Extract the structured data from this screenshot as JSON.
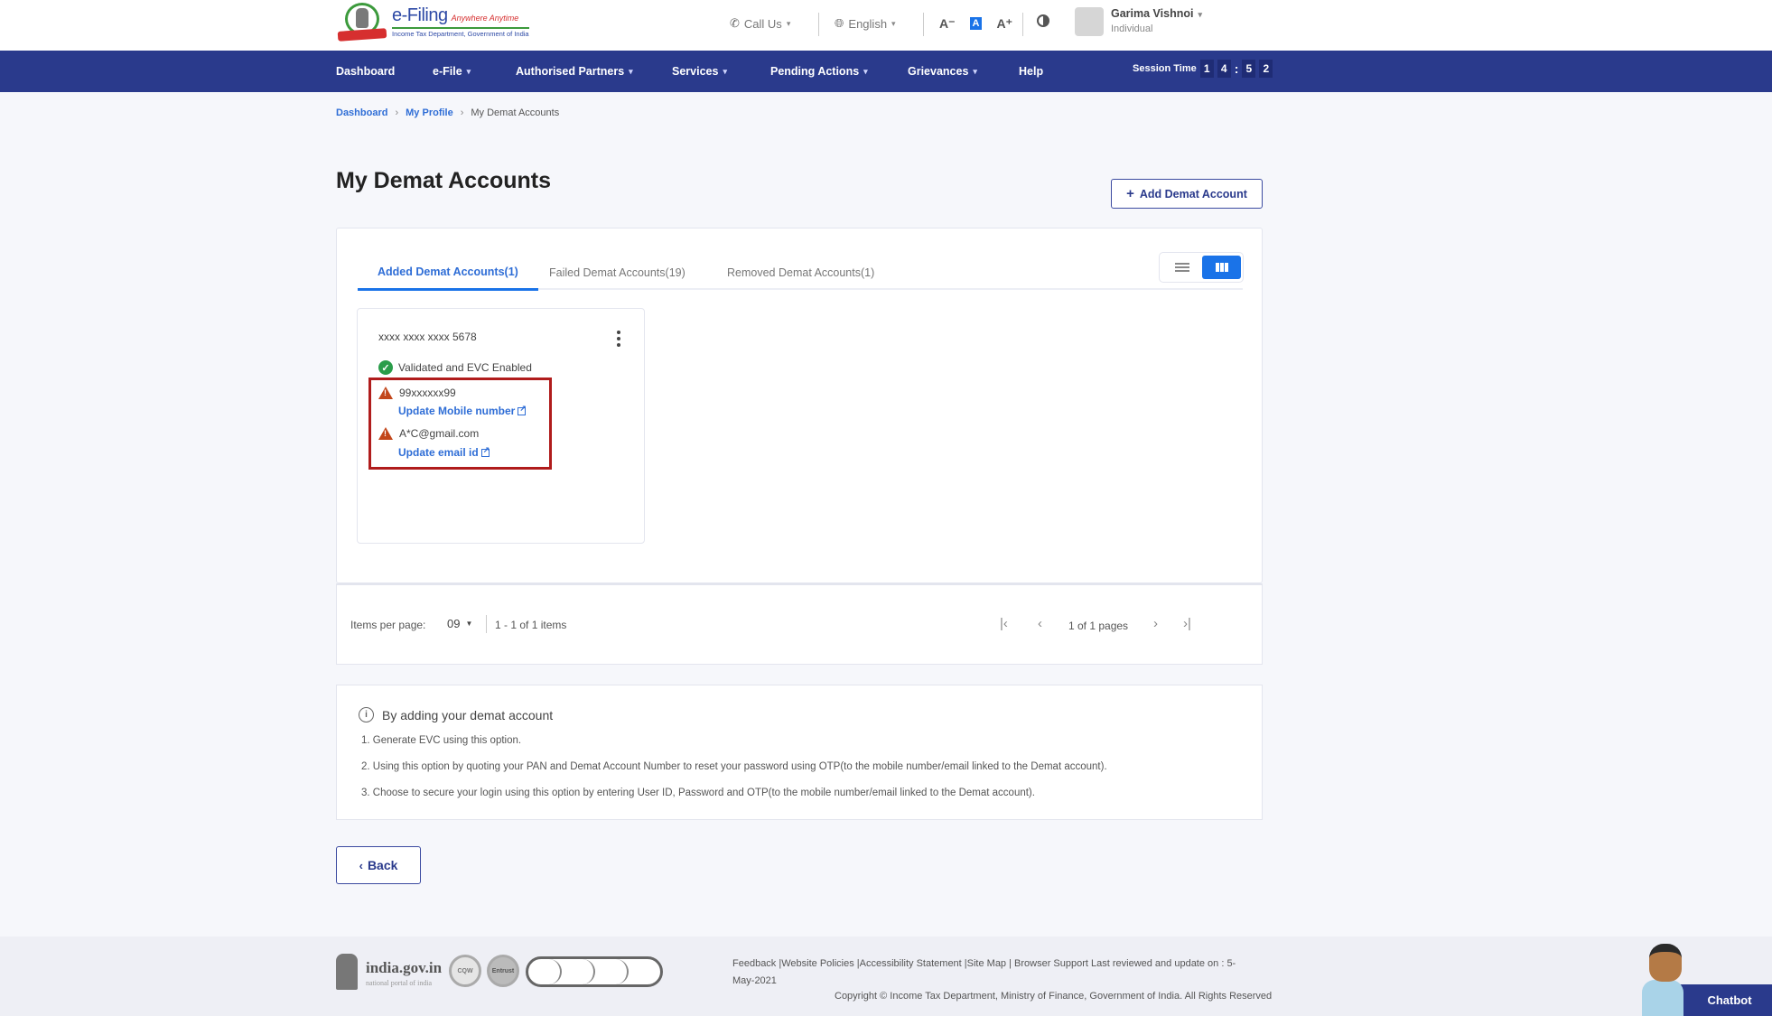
{
  "header": {
    "logo": {
      "title": "e-Filing",
      "tagline": "Anywhere Anytime",
      "subtitle": "Income Tax Department, Government of India"
    },
    "call_us": "Call Us",
    "language": "English",
    "font_decrease": "A⁻",
    "font_default": "A",
    "font_increase": "A⁺",
    "user": {
      "name": "Garima Vishnoi",
      "role": "Individual"
    }
  },
  "nav": {
    "items": [
      {
        "label": "Dashboard",
        "dropdown": false
      },
      {
        "label": "e-File",
        "dropdown": true
      },
      {
        "label": "Authorised Partners",
        "dropdown": true
      },
      {
        "label": "Services",
        "dropdown": true
      },
      {
        "label": "Pending Actions",
        "dropdown": true
      },
      {
        "label": "Grievances",
        "dropdown": true
      },
      {
        "label": "Help",
        "dropdown": false
      }
    ],
    "session_label": "Session Time",
    "session_digits": [
      "1",
      "4",
      "5",
      "2"
    ]
  },
  "breadcrumb": {
    "items": [
      "Dashboard",
      "My Profile"
    ],
    "current": "My Demat Accounts"
  },
  "page": {
    "title": "My Demat Accounts",
    "add_button": "Add Demat Account",
    "back_button": "Back"
  },
  "tabs": [
    {
      "label": "Added Demat Accounts(1)",
      "active": true
    },
    {
      "label": "Failed Demat Accounts(19)",
      "active": false
    },
    {
      "label": "Removed Demat Accounts(1)",
      "active": false
    }
  ],
  "view_mode": "grid",
  "card": {
    "account_number": "xxxx xxxx xxxx 5678",
    "status": "Validated and EVC Enabled",
    "mobile": "99xxxxxx99",
    "update_mobile": "Update Mobile number",
    "email": "A*C@gmail.com",
    "update_email": "Update email id"
  },
  "pagination": {
    "items_per_page_label": "Items per page:",
    "items_per_page": "09",
    "range": "1 - 1 of 1 items",
    "pages": "1 of 1 pages"
  },
  "info": {
    "heading": "By adding your demat account",
    "items": [
      "1. Generate EVC using this option.",
      "2. Using this option by quoting your PAN and Demat Account Number to reset your password using OTP(to the mobile number/email linked to the Demat account).",
      "3. Choose to secure your login using this option by entering User ID, Password and OTP(to the mobile number/email linked to the Demat account)."
    ]
  },
  "footer": {
    "india_gov": "india.gov.in",
    "india_gov_sub": "national portal of india",
    "badges": [
      "CQW",
      "Entrust"
    ],
    "links": "Feedback |Website Policies |Accessibility Statement |Site Map | Browser Support   Last reviewed and update on : 5-May-2021",
    "copyright": "Copyright © Income Tax Department, Ministry of Finance, Government of India. All Rights Reserved"
  },
  "chatbot": {
    "label": "Chatbot"
  },
  "colors": {
    "navbar": "#2a3a8c",
    "accent": "#1a73e8",
    "link": "#2e6dd6",
    "success": "#2a9d4a",
    "warning": "#c2461a",
    "highlight": "#b01c1c"
  }
}
